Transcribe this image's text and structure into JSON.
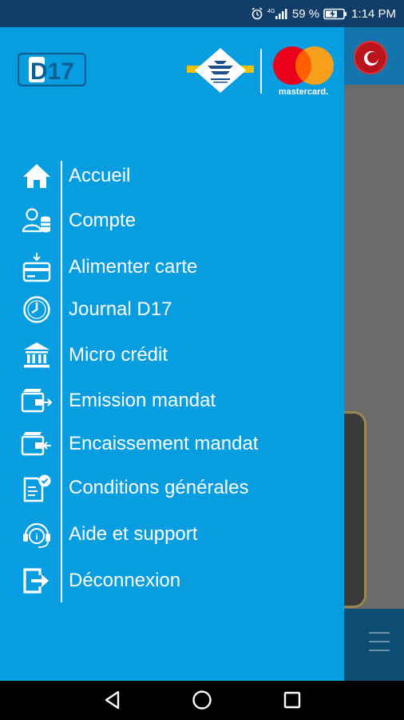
{
  "status_bar": {
    "battery_percent": "59 %",
    "time": "1:14 PM",
    "network_label": "4G"
  },
  "drawer": {
    "brand": "D17",
    "partner_logo_text": "mastercard.",
    "menu": [
      {
        "label": "Accueil",
        "icon": "home-icon"
      },
      {
        "label": "Compte",
        "icon": "account-icon"
      },
      {
        "label": "Alimenter carte",
        "icon": "card-topup-icon"
      },
      {
        "label": "Journal D17",
        "icon": "clock-icon"
      },
      {
        "label": "Micro crédit",
        "icon": "bank-icon"
      },
      {
        "label": "Emission mandat",
        "icon": "wallet-send-icon"
      },
      {
        "label": "Encaissement mandat",
        "icon": "wallet-receive-icon"
      },
      {
        "label": "Conditions générales",
        "icon": "document-check-icon"
      },
      {
        "label": "Aide et support",
        "icon": "headset-icon"
      },
      {
        "label": "Déconnexion",
        "icon": "logout-icon"
      }
    ]
  },
  "colors": {
    "drawer_bg": "#079ee1",
    "status_bar_bg": "#123d69",
    "app_header_bg": "#1474ac",
    "mastercard_red": "#eb001b",
    "mastercard_orange": "#f79e1b"
  }
}
